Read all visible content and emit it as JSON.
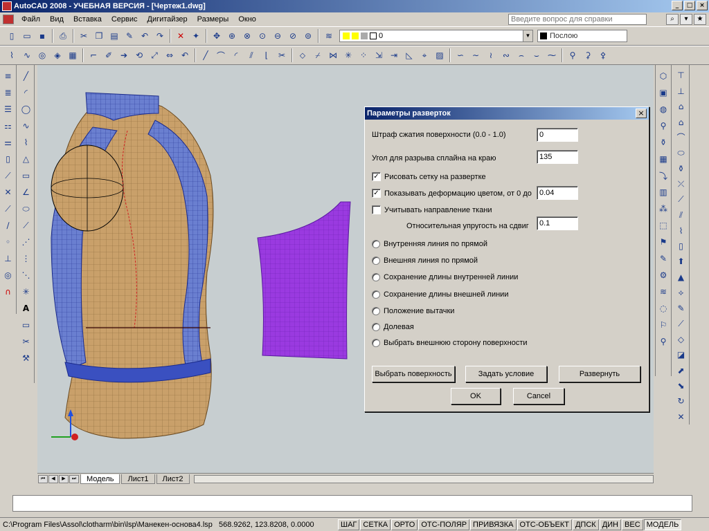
{
  "window": {
    "title": "AutoCAD 2008 - УЧЕБНАЯ ВЕРСИЯ - [Чертеж1.dwg]",
    "controls": [
      "_",
      "□",
      "×"
    ]
  },
  "menu": {
    "items": [
      "Файл",
      "Вид",
      "Вставка",
      "Сервис",
      "Дигитайзер",
      "Размеры",
      "Окно"
    ],
    "help_placeholder": "Введите вопрос для справки"
  },
  "toolbar": {
    "layer_value": "0",
    "color_value": "Послою"
  },
  "tabs": [
    "Модель",
    "Лист1",
    "Лист2"
  ],
  "status": {
    "path": "C:\\Program Files\\Assol\\clotharm\\bin\\lsp\\Манекен-основа4.lsp",
    "coords": "568.9262, 123.8208, 0.0000",
    "toggles": [
      "ШАГ",
      "СЕТКА",
      "ОРТО",
      "ОТС-ПОЛЯР",
      "ПРИВЯЗКА",
      "ОТС-ОБЪЕКТ",
      "ДПСК",
      "ДИН",
      "ВЕС",
      "МОДЕЛЬ"
    ]
  },
  "dialog": {
    "title": "Параметры разверток",
    "close": "×",
    "fields": {
      "penalty_label": "Штраф сжатия поверхности (0.0 - 1.0)",
      "penalty_value": "0",
      "angle_label": "Угол для разрыва сплайна на краю",
      "angle_value": "135",
      "draw_grid_label": "Рисовать сетку на развертке",
      "draw_grid_checked": true,
      "show_deform_label": "Показывать деформацию цветом, от 0 до",
      "show_deform_checked": true,
      "deform_value": "0.04",
      "fabric_dir_label": "Учитывать направление ткани",
      "fabric_dir_checked": false,
      "shear_label": "Относительная упругость на сдвиг",
      "shear_value": "0.1"
    },
    "radios": [
      "Внутренняя линия по прямой",
      "Внешняя линия по прямой",
      "Сохранение длины внутренней линии",
      "Сохранение длины внешней линии",
      "Положение вытачки",
      "Долевая",
      "Выбрать внешнюю сторону поверхности"
    ],
    "buttons": {
      "select_surface": "Выбрать поверхность",
      "set_condition": "Задать условие",
      "unfold": "Развернуть",
      "ok": "OK",
      "cancel": "Cancel"
    }
  }
}
